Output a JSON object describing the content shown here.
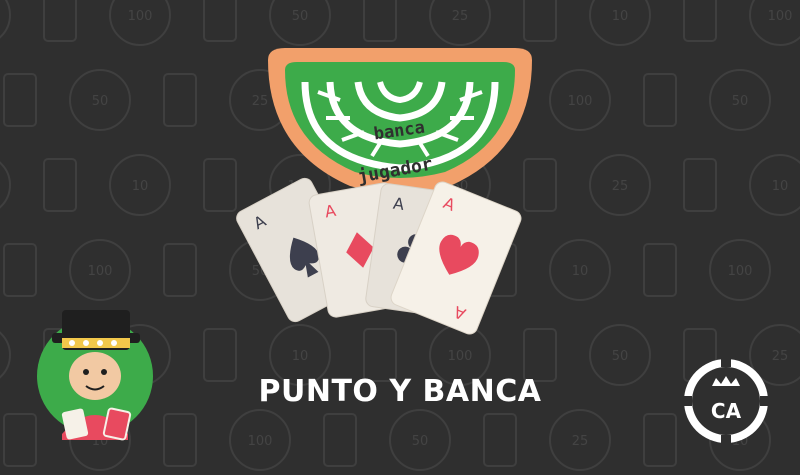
{
  "title": "PUNTO Y BANCA",
  "table": {
    "banker_label": "banca",
    "player_label": "jugador"
  },
  "cards": [
    {
      "rank": "A",
      "suit": "spade"
    },
    {
      "rank": "A",
      "suit": "diamond"
    },
    {
      "rank": "A",
      "suit": "club"
    },
    {
      "rank": "A",
      "suit": "heart"
    }
  ],
  "background_chips": [
    "10",
    "100",
    "50",
    "25"
  ],
  "logo": {
    "text": "CA"
  },
  "colors": {
    "background": "#2f2f2f",
    "felt_green": "#3dab4a",
    "table_rim": "#f2a06b",
    "card_face": "#f6f1e8",
    "heart_red": "#e84a5f"
  }
}
